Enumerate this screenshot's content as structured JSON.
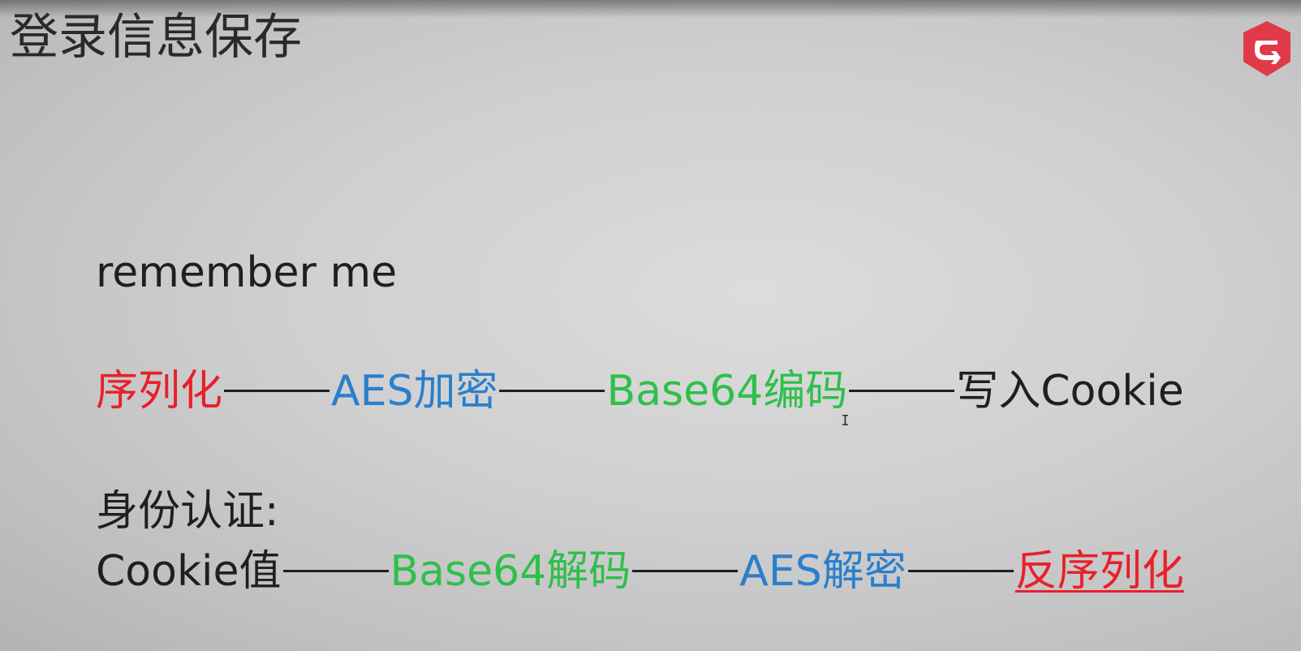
{
  "slide": {
    "title": "登录信息保存",
    "logo_icon": "shield-logo-icon",
    "cursor_icon": "text-cursor-icon"
  },
  "colors": {
    "red": "#e8202a",
    "blue": "#2a7fcc",
    "green": "#2fbf4a",
    "black": "#1f1f1f",
    "logo": "#e03a48"
  },
  "remember": {
    "label": "remember me"
  },
  "save_flow": {
    "step1": "序列化",
    "step2": "AES加密",
    "step3": "Base64编码",
    "step4": "写入Cookie"
  },
  "auth": {
    "label": "身份认证:"
  },
  "auth_flow": {
    "step1": "Cookie值",
    "step2": "Base64解码",
    "step3": "AES解密",
    "step4": "反序列化"
  }
}
